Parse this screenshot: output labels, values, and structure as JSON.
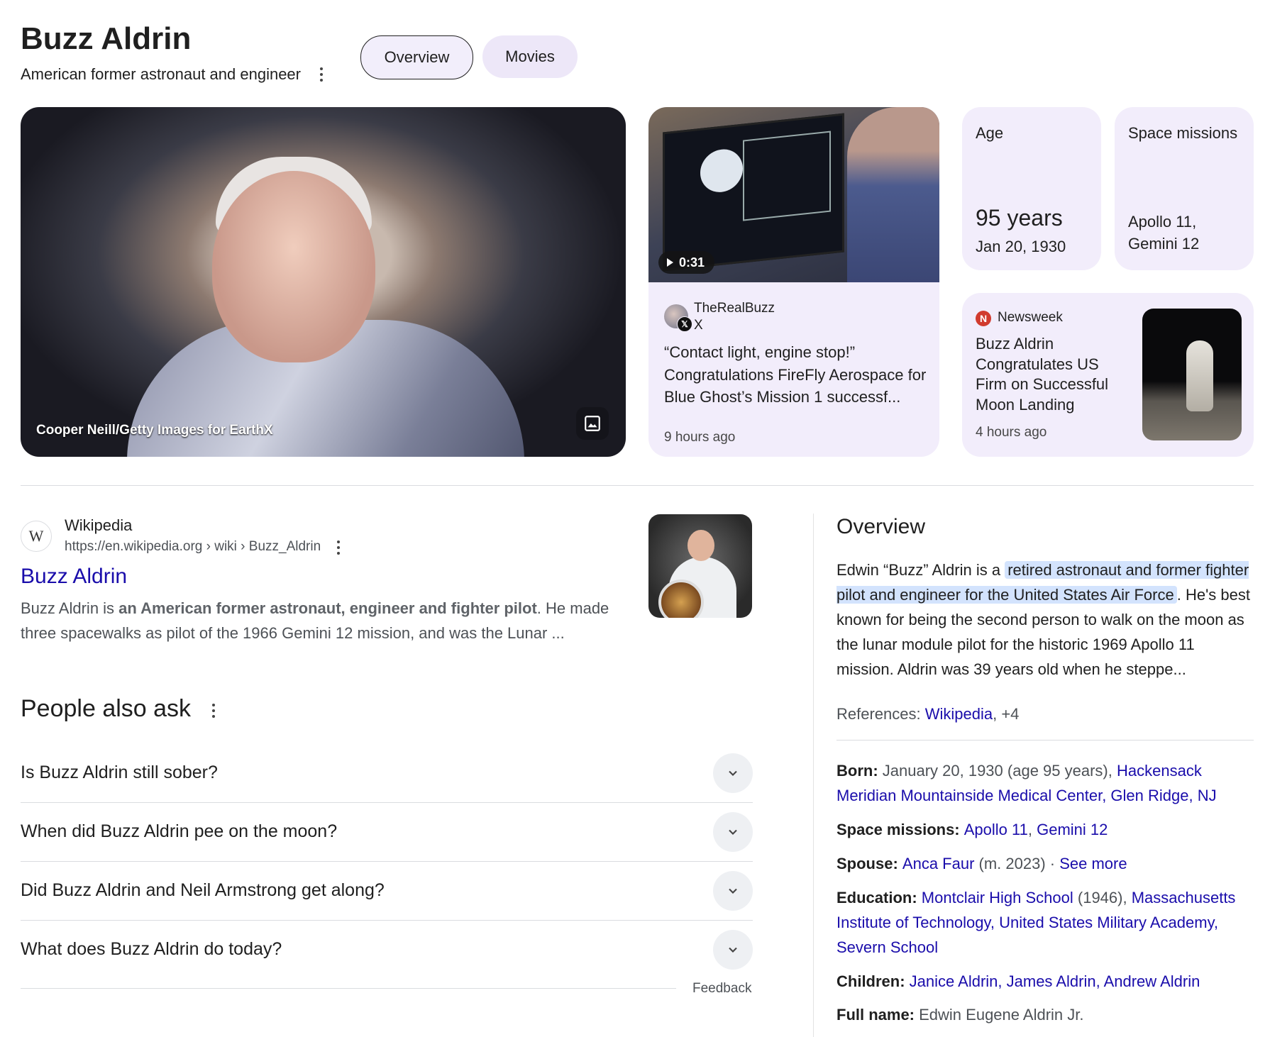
{
  "header": {
    "title": "Buzz Aldrin",
    "subtitle": "American former astronaut and engineer",
    "tabs": [
      {
        "label": "Overview"
      },
      {
        "label": "Movies"
      }
    ]
  },
  "hero": {
    "credit": "Cooper Neill/Getty Images for EarthX"
  },
  "video_card": {
    "duration": "0:31",
    "account": "TheRealBuzz",
    "platform": "X",
    "quote": "“Contact light, engine stop!” Congratulations FireFly Aerospace for Blue Ghost’s Mission 1 successf...",
    "time_ago": "9 hours ago"
  },
  "stats": [
    {
      "label": "Age",
      "value": "95 years",
      "detail": "Jan 20, 1930"
    },
    {
      "label": "Space missions",
      "line1": "Apollo 11,",
      "line2": "Gemini 12"
    }
  ],
  "news_card": {
    "source_logo": "N",
    "source": "Newsweek",
    "headline": "Buzz Aldrin Congratulates US Firm on Successful Moon Landing",
    "time_ago": "4 hours ago"
  },
  "wiki_result": {
    "logo": "W",
    "site": "Wikipedia",
    "url": "https://en.wikipedia.org › wiki › Buzz_Aldrin",
    "title": "Buzz Aldrin",
    "snippet_pre": "Buzz Aldrin is ",
    "snippet_bold": "an American former astronaut, engineer and fighter pilot",
    "snippet_post": ". He made three spacewalks as pilot of the 1966 Gemini 12 mission, and was the Lunar ..."
  },
  "people_also_ask": {
    "heading": "People also ask",
    "questions": [
      "Is Buzz Aldrin still sober?",
      "When did Buzz Aldrin pee on the moon?",
      "Did Buzz Aldrin and Neil Armstrong get along?",
      "What does Buzz Aldrin do today?"
    ],
    "feedback": "Feedback"
  },
  "overview": {
    "heading": "Overview",
    "text_pre": "Edwin “Buzz” Aldrin is a ",
    "text_highlight": "retired astronaut and former fighter pilot and engineer for the United States Air Force",
    "text_post": ". He's best known for being the second person to walk on the moon as the lunar module pilot for the historic 1969 Apollo 11 mission. Aldrin was 39 years old when he steppe...",
    "references_label": "References: ",
    "references_link": "Wikipedia",
    "references_more": ", +4"
  },
  "facts": {
    "born_label": "Born: ",
    "born_value": "January 20, 1930 (age 95 years), ",
    "born_link": "Hackensack Meridian Mountainside Medical Center, Glen Ridge, NJ",
    "missions_label": "Space missions: ",
    "missions_links": [
      "Apollo 11",
      "Gemini 12"
    ],
    "spouse_label": "Spouse: ",
    "spouse_link": "Anca Faur",
    "spouse_value": " (m. 2023) · ",
    "spouse_more": "See more",
    "education_label": "Education: ",
    "education_link1": "Montclair High School",
    "education_value": " (1946), ",
    "education_link2": "Massachusetts Institute of Technology, United States Military Academy, Severn School",
    "children_label": "Children: ",
    "children_link": "Janice Aldrin, James Aldrin, Andrew Aldrin",
    "fullname_label": "Full name: ",
    "fullname_value": "Edwin Eugene Aldrin Jr."
  },
  "colors": {
    "link": "#1a0dab",
    "card_bg": "#f2edfb",
    "highlight": "#d3e3fd"
  },
  "icons": [
    "more-vert-icon",
    "image-icon",
    "play-icon",
    "x-logo-icon",
    "newsweek-logo-icon",
    "wikipedia-logo-icon",
    "chevron-down-icon"
  ]
}
